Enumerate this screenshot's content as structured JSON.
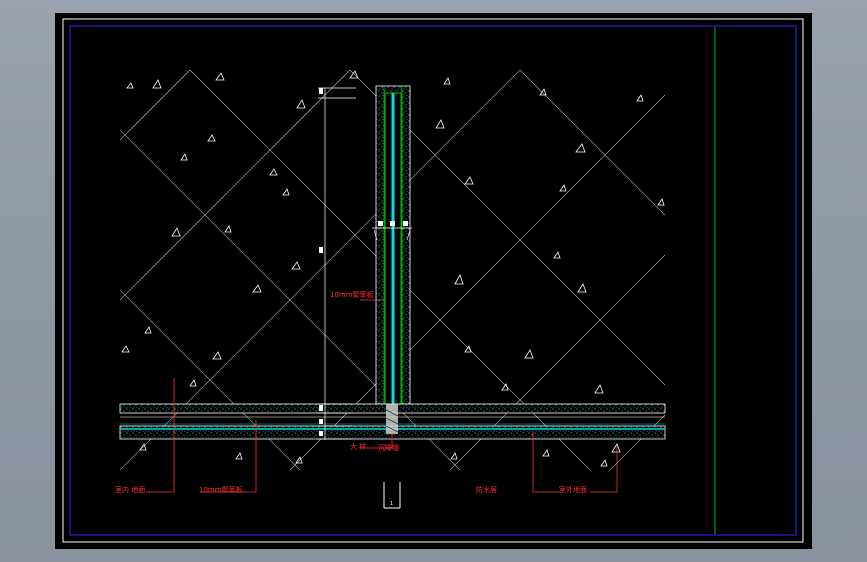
{
  "drawing": {
    "colors": {
      "background": "#000000",
      "frame": "#ffffff",
      "inner_frame": "#2a2aff",
      "title_divider": "#00c000",
      "hatch": "#c8c8c8",
      "insulation": "#00e0e0",
      "membrane": "#00c000",
      "dimension": "#ffffff",
      "label": "#ff3030",
      "leader": "#ff3030"
    },
    "labels": {
      "left_1": "室内 地面",
      "left_2": "10mm聚苯板",
      "wall_mid": "10mm聚苯板",
      "joint": "沉降缝",
      "joint_prefix": "大  样",
      "right_1": "防水层",
      "right_2": "室外地面",
      "section": "1"
    }
  }
}
